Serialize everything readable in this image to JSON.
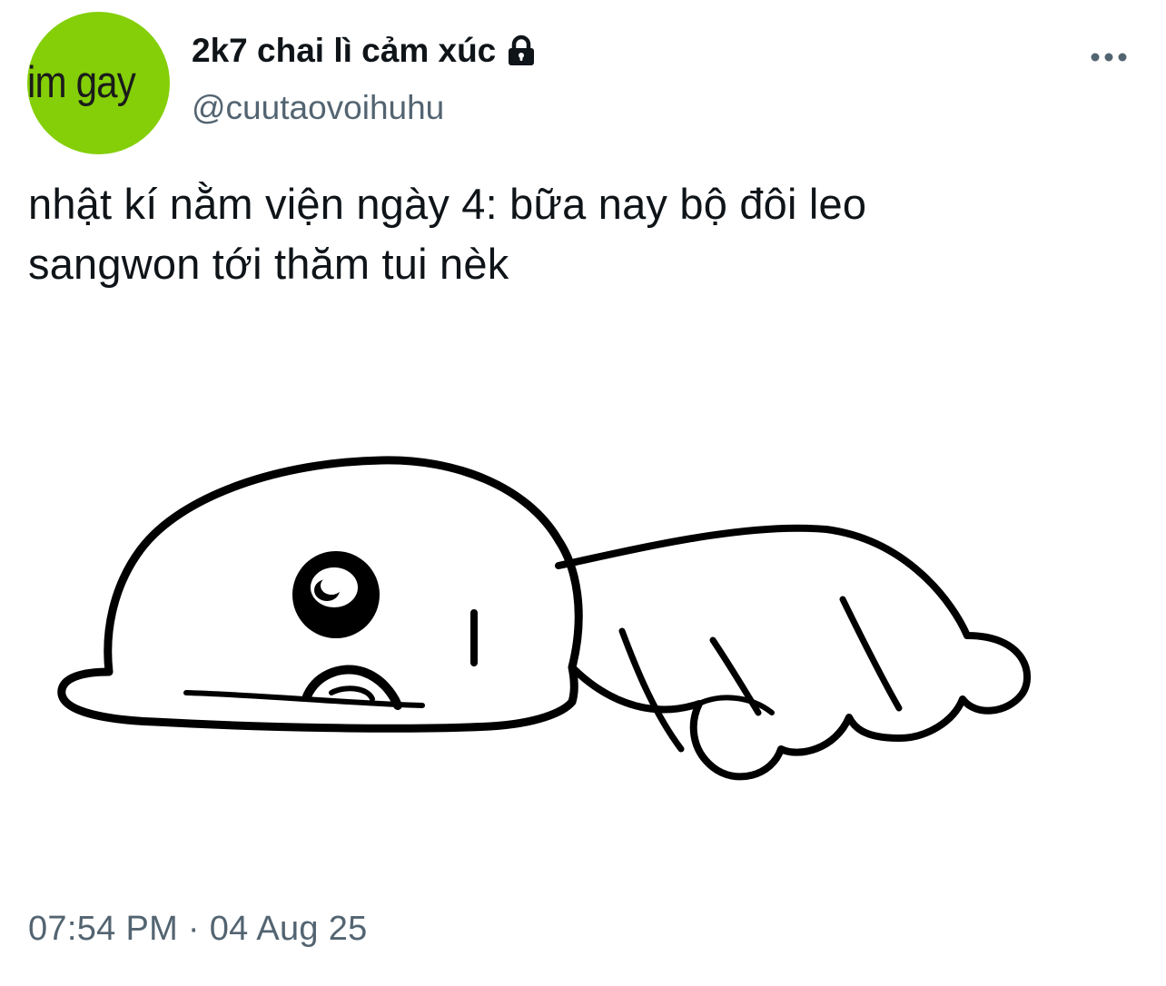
{
  "tweet": {
    "author": {
      "avatar_text": "im gay",
      "avatar_color": "#84cf08",
      "display_name": "2k7 chai lì cảm xúc",
      "protected_icon": "lock-icon",
      "handle": "@cuutaovoihuhu"
    },
    "more_icon": "more-horizontal-icon",
    "text_lines": [
      "nhật kí nằm viện ngày 4: bữa nay bộ đôi leo",
      "sangwon tới thăm tui nèk"
    ],
    "media": {
      "icon": "crying-blob-sticker"
    },
    "timestamp": "07:54 PM · 04 Aug 25"
  },
  "colors": {
    "text_primary": "#0f1419",
    "text_secondary": "#536471",
    "background": "#ffffff"
  }
}
